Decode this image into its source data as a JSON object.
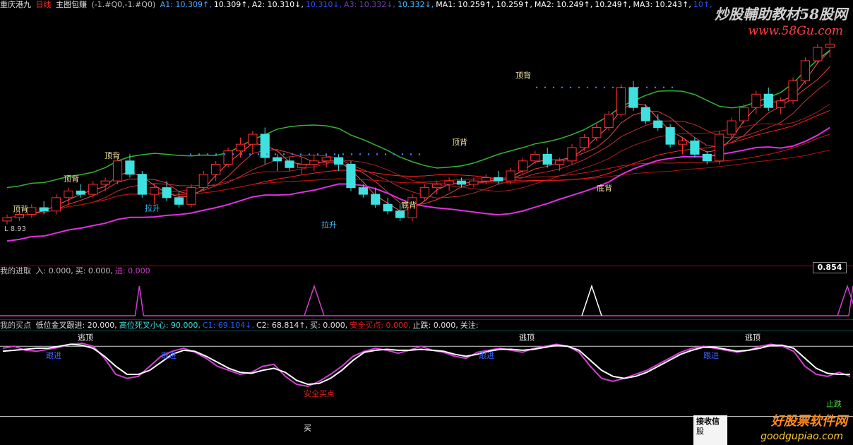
{
  "header": {
    "title": "重庆港九",
    "period": "日线",
    "indicator": "主图包赚",
    "params": "(-1.#Q0,-1.#Q0)",
    "items": [
      {
        "label": "A1:",
        "value": "10.309",
        "arrow": "↑",
        "color": "#4aa8ff"
      },
      {
        "label": "",
        "value": "10.309",
        "arrow": "↑",
        "color": "#ffffff"
      },
      {
        "label": "A2:",
        "value": "10.310",
        "arrow": "↓",
        "color": "#ffffff"
      },
      {
        "label": "",
        "value": "10.310",
        "arrow": "↓",
        "color": "#2850ff"
      },
      {
        "label": "A3:",
        "value": "10.332",
        "arrow": "↓",
        "color": "#7040a0"
      },
      {
        "label": "",
        "value": "10.332",
        "arrow": "↓",
        "color": "#40c0ff"
      },
      {
        "label": "MA1:",
        "value": "10.259",
        "arrow": "↑",
        "color": "#ffffff"
      },
      {
        "label": "",
        "value": "10.259",
        "arrow": "↑",
        "color": "#ffffff"
      },
      {
        "label": "MA2:",
        "value": "10.249",
        "arrow": "↑",
        "color": "#ffffff"
      },
      {
        "label": "",
        "value": "10.249",
        "arrow": "↑",
        "color": "#ffffff"
      },
      {
        "label": "MA3:",
        "value": "10.243",
        "arrow": "↑",
        "color": "#ffffff"
      },
      {
        "label": "",
        "value": "10",
        "arrow": "↑",
        "color": "#2850ff"
      }
    ]
  },
  "watermark": {
    "top_title": "炒股輔助教材58股网",
    "top_url": "www.58Gu.com",
    "bottom_title": "好股票软件网",
    "bottom_url": "goodgupiao.com"
  },
  "popup": {
    "line1": "接收信",
    "line2": "股"
  },
  "panel2": {
    "title": "我的进取",
    "items": [
      {
        "label": "入:",
        "value": "0.000,",
        "color": "#c0c0c0"
      },
      {
        "label": "买:",
        "value": "0.000,",
        "color": "#c0c0c0"
      },
      {
        "label": "进:",
        "value": "0.000",
        "color": "#d040d0"
      }
    ],
    "value_box": "0.854"
  },
  "panel3": {
    "title": "我的买点",
    "items": [
      {
        "text": "低位金叉跟进: 20.000,",
        "color": "#e0e0e0"
      },
      {
        "text": "高位死叉小心: 90.000,",
        "color": "#40e0e0"
      },
      {
        "text": "C1: 69.104↓,",
        "color": "#2060ff"
      },
      {
        "text": "C2: 68.814↑,",
        "color": "#e0e0e0"
      },
      {
        "text": "买: 0.000,",
        "color": "#e0e0e0"
      },
      {
        "text": "安全买点: 0.000,",
        "color": "#e02020"
      },
      {
        "text": "止跌: 0.000,",
        "color": "#e0e0e0"
      },
      {
        "text": "关注:",
        "color": "#e0e0e0"
      }
    ]
  },
  "chart_data": [
    {
      "type": "candlestick",
      "title": "重庆港九 日线",
      "price_label_left": "L 8.93",
      "candles": [
        [
          8.95,
          9.05,
          8.9,
          9.0
        ],
        [
          9.0,
          9.1,
          8.95,
          9.05
        ],
        [
          9.05,
          9.2,
          9.0,
          9.15
        ],
        [
          9.15,
          9.25,
          9.05,
          9.1
        ],
        [
          9.1,
          9.35,
          9.05,
          9.3
        ],
        [
          9.3,
          9.45,
          9.2,
          9.4
        ],
        [
          9.4,
          9.5,
          9.3,
          9.35
        ],
        [
          9.35,
          9.55,
          9.3,
          9.5
        ],
        [
          9.5,
          9.6,
          9.4,
          9.55
        ],
        [
          9.55,
          9.9,
          9.5,
          9.85
        ],
        [
          9.85,
          9.95,
          9.6,
          9.65
        ],
        [
          9.65,
          9.7,
          9.3,
          9.35
        ],
        [
          9.35,
          9.5,
          9.2,
          9.45
        ],
        [
          9.45,
          9.55,
          9.25,
          9.3
        ],
        [
          9.3,
          9.4,
          9.15,
          9.2
        ],
        [
          9.2,
          9.5,
          9.15,
          9.45
        ],
        [
          9.45,
          9.7,
          9.4,
          9.65
        ],
        [
          9.65,
          9.85,
          9.55,
          9.8
        ],
        [
          9.8,
          10.05,
          9.75,
          10.0
        ],
        [
          10.0,
          10.2,
          9.9,
          10.1
        ],
        [
          10.1,
          10.3,
          9.95,
          10.25
        ],
        [
          10.25,
          10.35,
          9.8,
          9.9
        ],
        [
          9.9,
          9.95,
          9.7,
          9.85
        ],
        [
          9.85,
          9.9,
          9.7,
          9.75
        ],
        [
          9.75,
          9.9,
          9.65,
          9.8
        ],
        [
          9.8,
          9.95,
          9.7,
          9.85
        ],
        [
          9.85,
          9.95,
          9.75,
          9.9
        ],
        [
          9.9,
          9.95,
          9.7,
          9.8
        ],
        [
          9.8,
          9.85,
          9.4,
          9.45
        ],
        [
          9.45,
          9.5,
          9.3,
          9.35
        ],
        [
          9.35,
          9.45,
          9.15,
          9.2
        ],
        [
          9.2,
          9.3,
          9.05,
          9.1
        ],
        [
          9.1,
          9.2,
          8.95,
          9.0
        ],
        [
          9.0,
          9.35,
          8.95,
          9.3
        ],
        [
          9.3,
          9.5,
          9.25,
          9.45
        ],
        [
          9.45,
          9.55,
          9.35,
          9.5
        ],
        [
          9.5,
          9.6,
          9.4,
          9.55
        ],
        [
          9.55,
          9.6,
          9.45,
          9.5
        ],
        [
          9.5,
          9.6,
          9.45,
          9.55
        ],
        [
          9.55,
          9.65,
          9.5,
          9.6
        ],
        [
          9.6,
          9.7,
          9.5,
          9.55
        ],
        [
          9.55,
          9.75,
          9.5,
          9.7
        ],
        [
          9.7,
          9.9,
          9.65,
          9.85
        ],
        [
          9.85,
          10.0,
          9.8,
          9.95
        ],
        [
          9.95,
          10.05,
          9.75,
          9.8
        ],
        [
          9.8,
          9.9,
          9.7,
          9.85
        ],
        [
          9.85,
          10.1,
          9.8,
          10.05
        ],
        [
          10.05,
          10.25,
          10.0,
          10.2
        ],
        [
          10.2,
          10.4,
          10.15,
          10.35
        ],
        [
          10.35,
          10.6,
          10.3,
          10.55
        ],
        [
          10.55,
          11.0,
          10.5,
          10.95
        ],
        [
          10.95,
          11.05,
          10.6,
          10.65
        ],
        [
          10.65,
          10.7,
          10.4,
          10.45
        ],
        [
          10.45,
          10.55,
          10.3,
          10.35
        ],
        [
          10.35,
          10.4,
          10.05,
          10.1
        ],
        [
          10.1,
          10.2,
          9.95,
          10.15
        ],
        [
          10.15,
          10.2,
          9.9,
          9.95
        ],
        [
          9.95,
          10.0,
          9.8,
          9.85
        ],
        [
          9.85,
          10.3,
          9.8,
          10.25
        ],
        [
          10.25,
          10.5,
          10.2,
          10.45
        ],
        [
          10.45,
          10.7,
          10.4,
          10.65
        ],
        [
          10.65,
          10.9,
          10.55,
          10.85
        ],
        [
          10.85,
          10.95,
          10.6,
          10.65
        ],
        [
          10.65,
          10.8,
          10.55,
          10.75
        ],
        [
          10.75,
          11.1,
          10.7,
          11.05
        ],
        [
          11.05,
          11.4,
          11.0,
          11.35
        ],
        [
          11.35,
          11.6,
          11.3,
          11.55
        ],
        [
          11.55,
          11.7,
          11.4,
          11.6
        ]
      ],
      "annotations": [
        "顶背",
        "顶背",
        "顶背",
        "拉升",
        "拉升",
        "顶背",
        "底背",
        "顶背",
        "底背"
      ],
      "ma_series": [
        "MA1",
        "MA2",
        "MA3"
      ]
    },
    {
      "type": "line",
      "title": "我的进取",
      "series": [
        {
          "name": "进",
          "values": [
            0,
            0,
            0,
            0,
            0,
            0,
            0,
            0,
            0,
            0,
            0,
            0,
            0,
            0,
            0,
            0,
            0,
            0,
            0,
            0,
            0,
            0,
            0,
            0,
            0,
            0,
            0,
            0,
            0,
            0,
            0,
            0,
            0,
            1,
            0,
            0,
            0,
            0,
            0,
            0,
            0,
            0,
            0,
            0,
            0,
            0,
            0,
            0,
            0,
            0,
            0,
            0,
            0,
            0,
            0,
            0,
            0,
            0,
            0,
            0,
            0,
            0,
            0,
            0,
            0,
            0,
            0,
            0,
            0,
            0,
            0,
            0,
            0,
            0,
            0,
            0,
            0,
            0,
            0,
            0,
            0,
            0,
            0,
            0,
            0,
            0,
            0,
            0,
            0,
            0,
            0,
            0,
            0,
            0,
            0,
            0,
            0,
            0,
            0,
            0,
            0,
            0,
            0,
            0,
            0,
            0,
            0,
            0,
            0,
            0,
            0,
            0,
            0,
            0,
            0,
            0,
            0,
            0,
            0,
            0,
            0,
            0,
            0,
            0,
            0,
            0,
            0,
            0,
            0,
            0,
            0,
            0,
            0,
            0,
            0,
            0,
            0,
            0,
            0,
            0,
            0,
            0,
            0,
            0,
            0,
            0,
            0,
            0,
            0,
            0,
            0,
            0,
            0,
            0,
            0,
            0,
            0,
            0,
            0,
            0,
            0,
            0,
            0,
            0,
            0,
            0,
            0,
            0,
            0,
            0,
            0,
            0,
            0,
            0,
            0,
            0,
            0,
            0,
            0,
            0,
            0,
            0,
            0,
            0,
            0,
            0,
            0,
            0,
            0,
            0,
            0,
            0,
            0,
            0,
            0,
            0,
            0,
            0,
            0,
            0,
            0,
            0,
            1
          ]
        }
      ],
      "peaks_x_index": [
        33,
        64,
        92
      ]
    },
    {
      "type": "line",
      "title": "我的买点",
      "ylim": [
        0,
        100
      ],
      "series": [
        {
          "name": "C1",
          "color": "#d040d0",
          "values": [
            88,
            90,
            86,
            85,
            87,
            89,
            92,
            93,
            90,
            78,
            62,
            58,
            60,
            70,
            80,
            85,
            88,
            84,
            78,
            70,
            66,
            62,
            64,
            70,
            72,
            60,
            52,
            50,
            55,
            62,
            70,
            80,
            85,
            88,
            86,
            83,
            86,
            90,
            86,
            84,
            80,
            78,
            84,
            86,
            88,
            86,
            84,
            88,
            90,
            92,
            90,
            84,
            70,
            58,
            55,
            58,
            62,
            66,
            72,
            78,
            84,
            88,
            90,
            88,
            86,
            84,
            86,
            90,
            92,
            90,
            85,
            70,
            62,
            60,
            64,
            60
          ]
        },
        {
          "name": "C2",
          "color": "#ffffff",
          "values": [
            85,
            86,
            87,
            88,
            88,
            90,
            92,
            91,
            88,
            80,
            70,
            62,
            62,
            66,
            74,
            82,
            86,
            85,
            80,
            74,
            68,
            64,
            63,
            66,
            68,
            64,
            56,
            52,
            53,
            58,
            66,
            76,
            84,
            86,
            87,
            86,
            86,
            87,
            86,
            85,
            82,
            80,
            82,
            85,
            87,
            87,
            86,
            87,
            89,
            91,
            90,
            86,
            76,
            66,
            60,
            58,
            60,
            64,
            70,
            76,
            82,
            86,
            89,
            89,
            87,
            85,
            86,
            88,
            91,
            91,
            88,
            78,
            68,
            63,
            62,
            62
          ]
        }
      ],
      "annotations": [
        "逃顶",
        "逃顶",
        "逃顶",
        "逃顶",
        "跟进",
        "跟进",
        "跟进",
        "跟进",
        "买",
        "安全买点",
        "止跌"
      ],
      "reference_lines": [
        20,
        90
      ]
    }
  ]
}
